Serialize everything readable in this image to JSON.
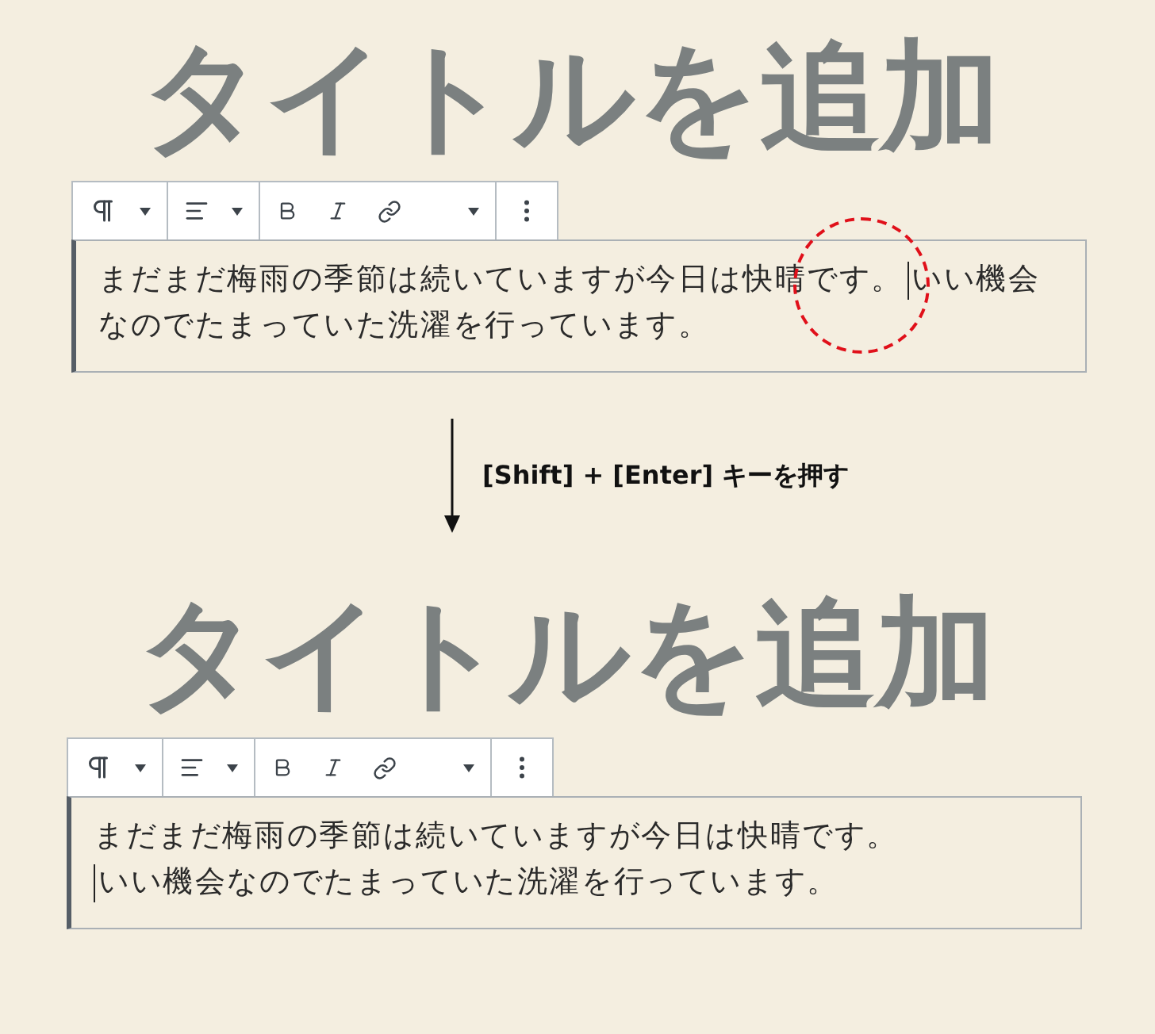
{
  "steps": [
    {
      "title": "タイトルを追加",
      "cursor_marked": true,
      "lines": [
        {
          "text": "まだまだ梅雨の季節は続いていますが今日は快晴です。",
          "cursor_after": true,
          "text_after": "いい機会"
        },
        {
          "text": "なのでたまっていた洗濯を行っています。"
        }
      ]
    },
    {
      "title": "タイトルを追加",
      "lines": [
        {
          "text": "まだまだ梅雨の季節は続いていますが今日は快晴です。"
        },
        {
          "text": "いい機会なのでたまっていた洗濯を行っています。",
          "cursor_before": true
        }
      ]
    }
  ],
  "arrow_caption": "[Shift] + [Enter] キーを押す"
}
